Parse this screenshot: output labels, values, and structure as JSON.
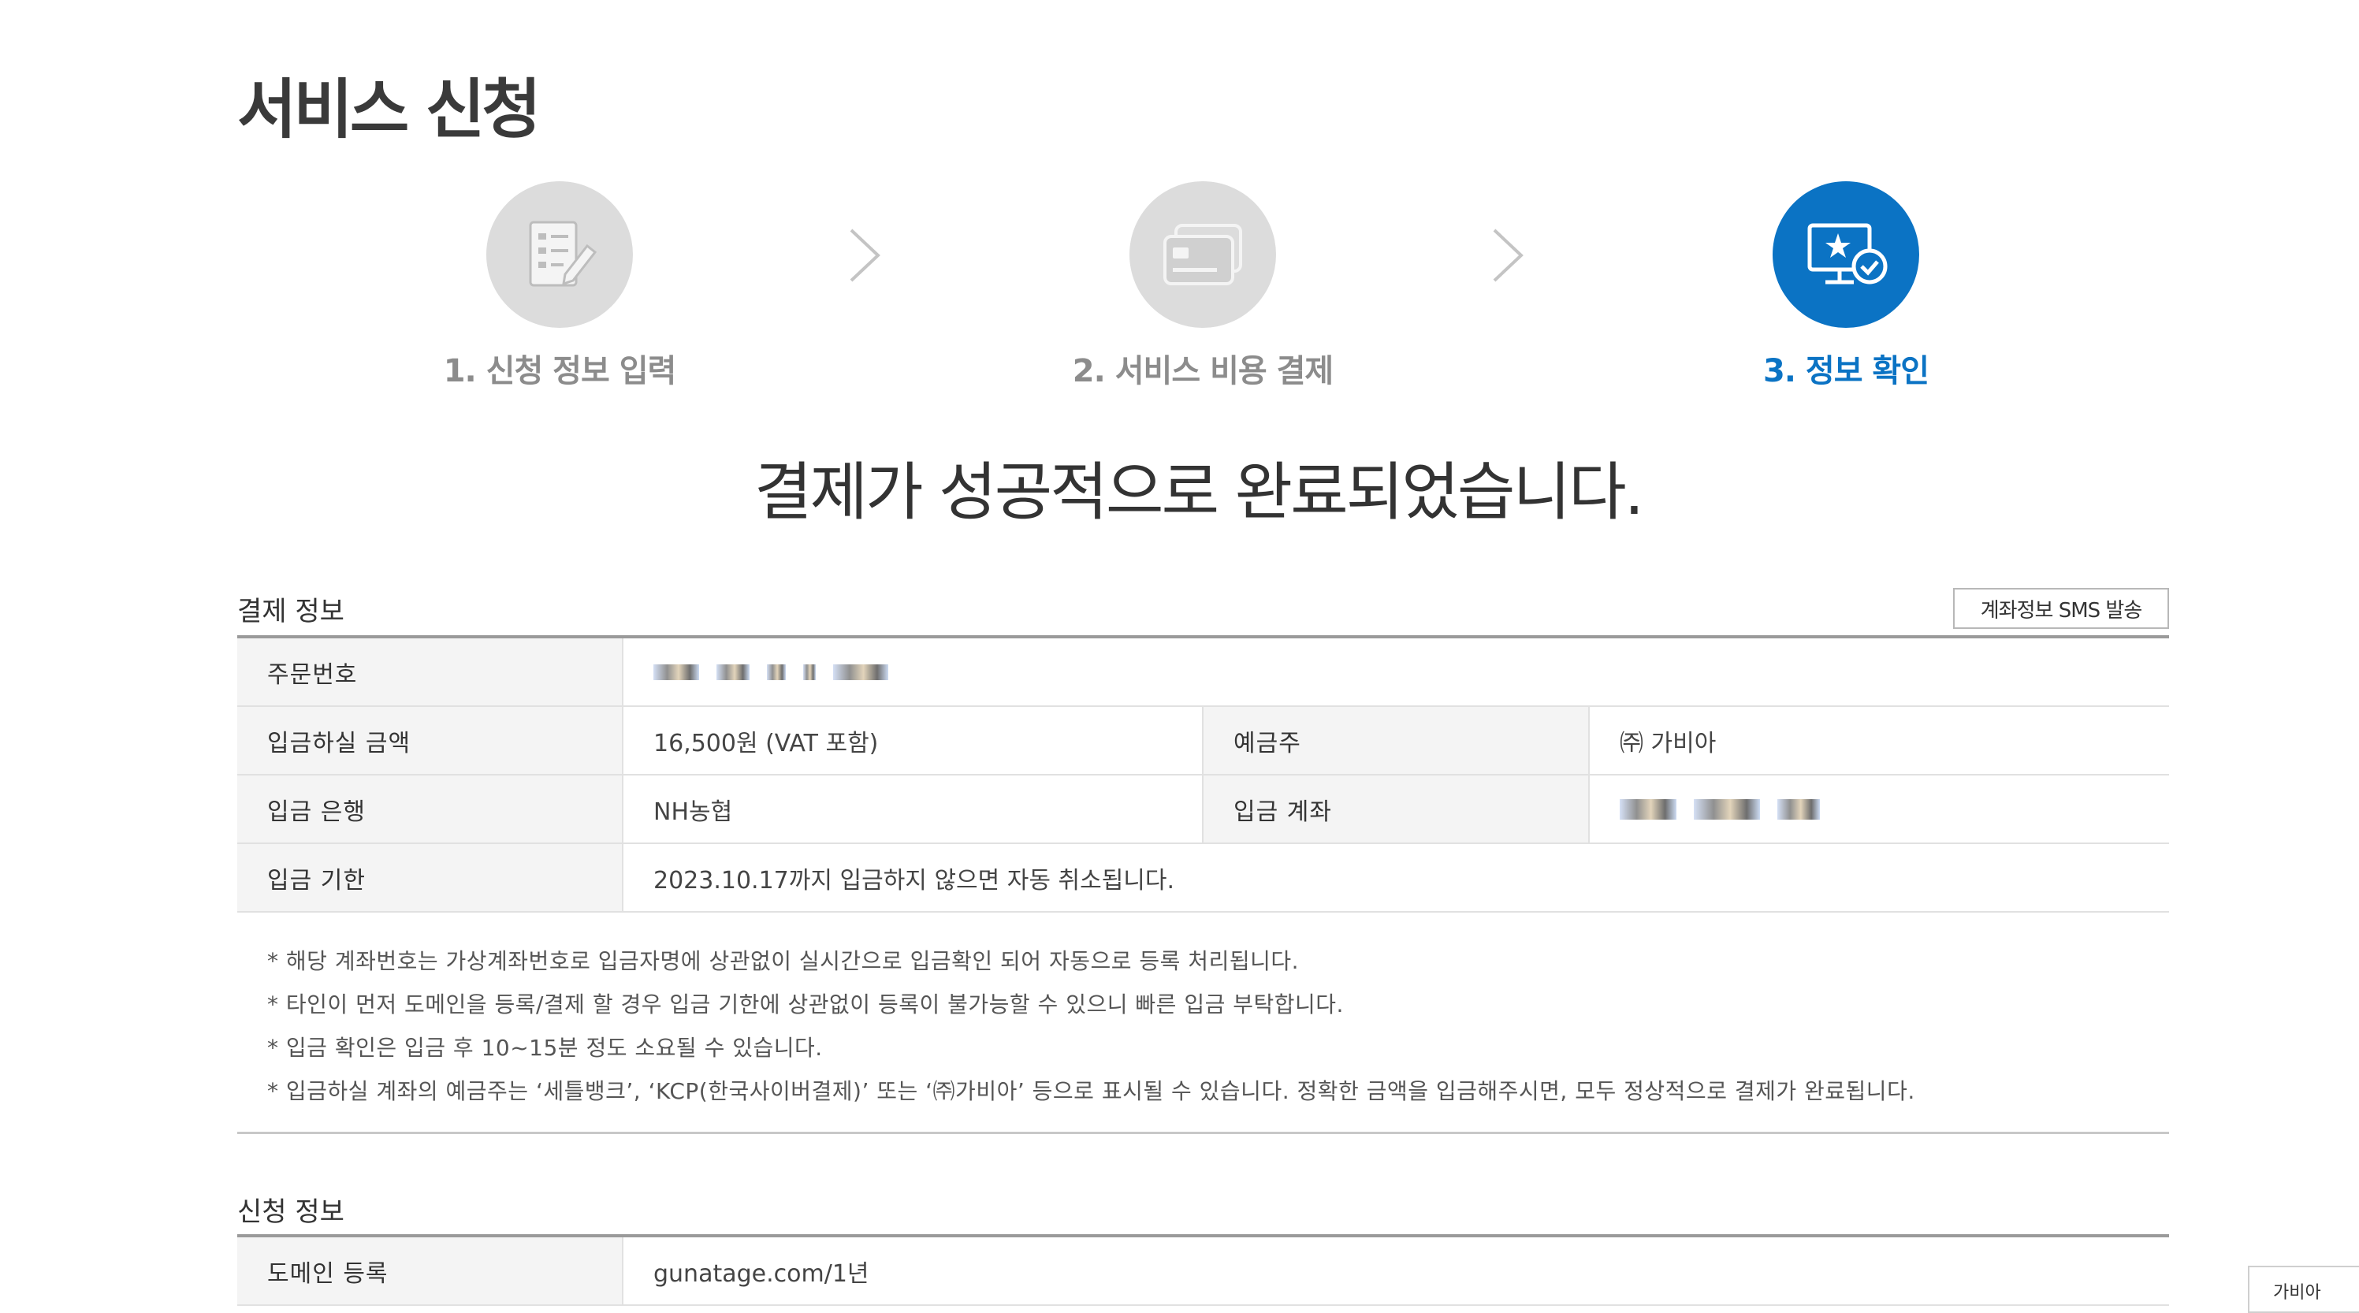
{
  "page": {
    "title": "서비스 신청"
  },
  "steps": [
    {
      "label": "1. 신청 정보 입력",
      "state": "done",
      "icon": "form-edit-icon"
    },
    {
      "label": "2. 서비스 비용 결제",
      "state": "done",
      "icon": "credit-card-icon"
    },
    {
      "label": "3. 정보 확인",
      "state": "active",
      "icon": "monitor-star-check-icon"
    }
  ],
  "message": "결제가 성공적으로 완료되었습니다.",
  "payment": {
    "title": "결제 정보",
    "sms_button": "계좌정보 SMS 발송",
    "order_number_label": "주문번호",
    "amount_label": "입금하실 금액",
    "amount_value": "16,500원 (VAT 포함)",
    "holder_label": "예금주",
    "holder_value": "㈜ 가비아",
    "bank_label": "입금 은행",
    "bank_value": "NH농협",
    "account_label": "입금 계좌",
    "deadline_label": "입금 기한",
    "deadline_value": "2023.10.17까지 입금하지 않으면 자동 취소됩니다."
  },
  "notes": [
    "* 해당 계좌번호는 가상계좌번호로 입금자명에 상관없이 실시간으로 입금확인 되어 자동으로 등록 처리됩니다.",
    "* 타인이 먼저 도메인을 등록/결제 할 경우 입금 기한에 상관없이 등록이 불가능할 수 있으니 빠른 입금 부탁합니다.",
    "* 입금 확인은 입금 후 10~15분 정도 소요될 수 있습니다.",
    "* 입금하실 계좌의 예금주는 ‘세틀뱅크’, ‘KCP(한국사이버결제)’ 또는 ‘㈜가비아’ 등으로 표시될 수 있습니다. 정확한 금액을 입금해주시면, 모두 정상적으로 결제가 완료됩니다."
  ],
  "application": {
    "title": "신청 정보",
    "domain_label": "도메인 등록",
    "domain_value": "gunatage.com/1년"
  },
  "corner_tab": "가비아",
  "colors": {
    "accent": "#0b73c4",
    "inactive_step": "#dcdcdc",
    "label_bg": "#f4f4f4"
  }
}
